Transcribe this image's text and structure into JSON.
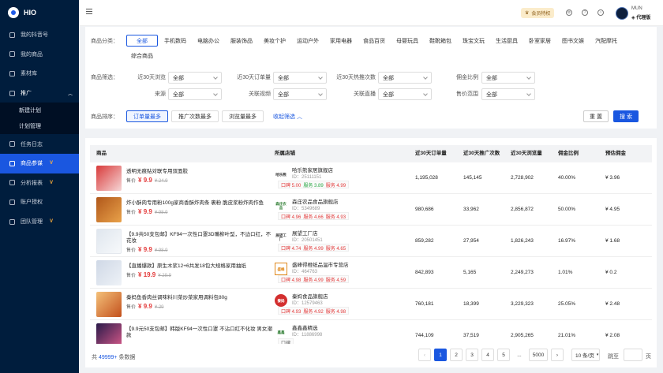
{
  "app": {
    "name": "HIO"
  },
  "sidebar": {
    "items": [
      {
        "label": "我的抖音号"
      },
      {
        "label": "我的商品"
      },
      {
        "label": "素材库"
      },
      {
        "label": "推广"
      },
      {
        "label": "新建计划"
      },
      {
        "label": "计划管理"
      },
      {
        "label": "任务日志"
      },
      {
        "label": "商品参谋"
      },
      {
        "label": "分析报表"
      },
      {
        "label": "账户授权"
      },
      {
        "label": "团队管理"
      }
    ]
  },
  "topbar": {
    "vip_label": "会员特权",
    "user_name": "MUN",
    "user_role": "代理版"
  },
  "filter": {
    "category_label": "商品分类：",
    "categories": [
      "全部",
      "手机数码",
      "电脑办公",
      "服装饰品",
      "美妆个护",
      "运动户外",
      "家用电器",
      "食品百货",
      "母婴玩具",
      "鞋靴箱包",
      "珠宝文玩",
      "生活厨具",
      "卧室家居",
      "图书文娱",
      "汽配摩托",
      "综合商品"
    ],
    "screen_label": "商品筛选：",
    "fields": [
      {
        "label": "近30天浏览",
        "value": "全部"
      },
      {
        "label": "近30天订单量",
        "value": "全部"
      },
      {
        "label": "近30天热推次数",
        "value": "全部"
      },
      {
        "label": "佣金比例",
        "value": "全部"
      },
      {
        "label": "来源",
        "value": "全部"
      },
      {
        "label": "关联视频",
        "value": "全部"
      },
      {
        "label": "关联直播",
        "value": "全部"
      },
      {
        "label": "售价范围",
        "value": "全部"
      }
    ],
    "sort_label": "商品排序：",
    "sorts": [
      "订单量最多",
      "推广次数最多",
      "浏览量最多"
    ],
    "collapse_label": "收起筛选",
    "reset_label": "重 置",
    "search_label": "搜 索"
  },
  "table": {
    "headers": [
      "商品",
      "所属店铺",
      "近30天订单量",
      "近30天推广次数",
      "近30天浏览量",
      "佣金比例",
      "预估佣金"
    ],
    "price_label": "售价",
    "rows": [
      {
        "name": "透明无痕贴对联专用双面胶",
        "price": "¥ 9.9",
        "orig": "¥ 24.9",
        "logo": "哈乐熊",
        "shop": "哈乐熊家居旗舰店",
        "id": "ID：25111151",
        "s1": "口碑 5.00",
        "s2": "服务 3.89",
        "s3": "服务 4.99",
        "orders": "1,195,028",
        "promos": "145,145",
        "views": "2,728,902",
        "rate": "40.00%",
        "commission": "¥ 3.96"
      },
      {
        "name": "炸小酥肉专用粉100g家商香酥炸肉条 裹粉 脆皮浆粉炸肉作鱼",
        "price": "¥ 9.9",
        "orig": "¥ 98.9",
        "logo": "森庄农品",
        "shop": "森庄农品食品旗舰店",
        "id": "ID：5349689",
        "s1": "口碑 4.96",
        "s2": "服务 4.66",
        "s3": "服务 4.93",
        "orders": "980,686",
        "promos": "33,962",
        "views": "2,856,872",
        "rate": "50.00%",
        "commission": "¥ 4.95"
      },
      {
        "name": "【9.9共50支包邮】KF94一次性口罩3D嘴柳叶型，不边口红，不花妆",
        "price": "¥ 9.9",
        "orig": "¥ 98.9",
        "logo": "展望工厂",
        "shop": "展望工厂店",
        "id": "ID：20501451",
        "s1": "口碑 4.74",
        "s2": "服务 4.99",
        "s3": "服务 4.65",
        "orders": "859,282",
        "promos": "27,954",
        "views": "1,826,243",
        "rate": "16.97%",
        "commission": "¥ 1.68"
      },
      {
        "name": "【直播爆款】原生木浆12+6共发18包大规格家用抽纸",
        "price": "¥ 19.9",
        "orig": "¥ 29.9",
        "logo": "盛峰",
        "shop": "盛峰得橙纸品温市专营店",
        "id": "ID：464763",
        "s1": "口碑 4.98",
        "s2": "服务 4.99",
        "s3": "服务 4.59",
        "orders": "842,893",
        "promos": "5,165",
        "views": "2,249,273",
        "rate": "1.01%",
        "commission": "¥ 0.2"
      },
      {
        "name": "秦妈鱼香肉丝调味料川菜炒菜家用调料包80g",
        "price": "¥ 9.9",
        "orig": "¥ 29",
        "logo": "秦妈",
        "shop": "秦妈食品旗舰店",
        "id": "ID：12579463",
        "s1": "口碑 4.93",
        "s2": "服务 4.92",
        "s3": "服务 4.98",
        "orders": "760,181",
        "promos": "18,399",
        "views": "3,229,323",
        "rate": "25.05%",
        "commission": "¥ 2.48"
      },
      {
        "name": "【9.9元50支包邮】韩版KF94一次性口罩 不沾口红不化妆 男女潮款",
        "price": "¥ 9.9",
        "orig": "¥ 99",
        "logo": "鑫鑫",
        "shop": "鑫鑫鑫精选",
        "id": "ID：11886998",
        "s1": "口碑",
        "s2": "",
        "s3": "",
        "orders": "744,109",
        "promos": "37,519",
        "views": "2,905,265",
        "rate": "21.01%",
        "commission": "¥ 2.08"
      }
    ]
  },
  "pager": {
    "total_prefix": "共",
    "total_count": "49999+",
    "total_suffix": "条数据",
    "pages": [
      "1",
      "2",
      "3",
      "4",
      "5",
      "...",
      "5000"
    ],
    "page_size": "10 条/页",
    "goto_label": "跳至",
    "page_unit": "页",
    "prev": "‹",
    "next": "›"
  }
}
